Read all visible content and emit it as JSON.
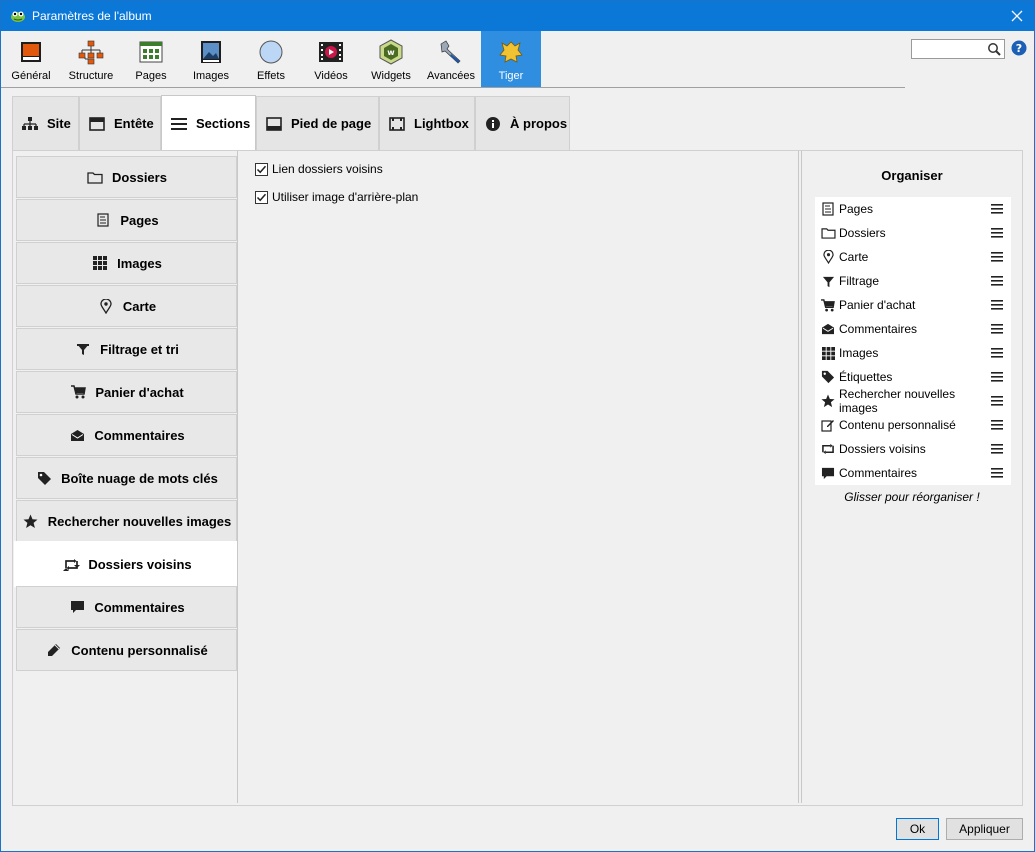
{
  "window": {
    "title": "Paramètres de l'album",
    "accent": "#0b78d7"
  },
  "toolbar": {
    "items": [
      {
        "label": "Général",
        "icon": "general-icon"
      },
      {
        "label": "Structure",
        "icon": "structure-icon"
      },
      {
        "label": "Pages",
        "icon": "pages-icon"
      },
      {
        "label": "Images",
        "icon": "images-icon"
      },
      {
        "label": "Effets",
        "icon": "effects-icon"
      },
      {
        "label": "Vidéos",
        "icon": "videos-icon"
      },
      {
        "label": "Widgets",
        "icon": "widgets-icon"
      },
      {
        "label": "Avancées",
        "icon": "advanced-icon"
      },
      {
        "label": "Tiger",
        "icon": "tiger-icon"
      }
    ],
    "active": "Tiger",
    "search_value": ""
  },
  "tabs": {
    "items": [
      {
        "label": "Site",
        "icon": "sitemap-icon"
      },
      {
        "label": "Entête",
        "icon": "header-icon"
      },
      {
        "label": "Sections",
        "icon": "list-icon"
      },
      {
        "label": "Pied de page",
        "icon": "footer-icon"
      },
      {
        "label": "Lightbox",
        "icon": "lightbox-icon"
      },
      {
        "label": "À propos",
        "icon": "info-icon"
      }
    ],
    "active": "Sections"
  },
  "sections": {
    "items": [
      {
        "label": "Dossiers",
        "icon": "folder-icon"
      },
      {
        "label": "Pages",
        "icon": "page-icon"
      },
      {
        "label": "Images",
        "icon": "grid-icon"
      },
      {
        "label": "Carte",
        "icon": "map-marker-icon"
      },
      {
        "label": "Filtrage et tri",
        "icon": "filter-icon"
      },
      {
        "label": "Panier d'achat",
        "icon": "cart-icon"
      },
      {
        "label": "Commentaires",
        "icon": "envelope-open-icon"
      },
      {
        "label": "Boîte nuage de mots clés",
        "icon": "tag-icon"
      },
      {
        "label": "Rechercher nouvelles images",
        "icon": "star-icon"
      },
      {
        "label": "Dossiers voisins",
        "icon": "retweet-icon"
      },
      {
        "label": "Commentaires",
        "icon": "comment-icon"
      },
      {
        "label": "Contenu personnalisé",
        "icon": "pencil-icon"
      }
    ],
    "active": "Dossiers voisins"
  },
  "options": {
    "link_neighbors": {
      "label": "Lien dossiers voisins",
      "checked": true
    },
    "use_background": {
      "label": "Utiliser image d'arrière-plan",
      "checked": true
    }
  },
  "organiser": {
    "title": "Organiser",
    "items": [
      {
        "label": "Pages",
        "icon": "page-icon"
      },
      {
        "label": "Dossiers",
        "icon": "folder-icon"
      },
      {
        "label": "Carte",
        "icon": "map-marker-icon"
      },
      {
        "label": "Filtrage",
        "icon": "filter-icon"
      },
      {
        "label": "Panier d'achat",
        "icon": "cart-icon"
      },
      {
        "label": "Commentaires",
        "icon": "envelope-open-icon"
      },
      {
        "label": "Images",
        "icon": "grid-icon"
      },
      {
        "label": "Étiquettes",
        "icon": "tag-icon"
      },
      {
        "label": "Rechercher nouvelles images",
        "icon": "star-icon"
      },
      {
        "label": "Contenu personnalisé",
        "icon": "edit-icon"
      },
      {
        "label": "Dossiers voisins",
        "icon": "retweet-icon"
      },
      {
        "label": "Commentaires",
        "icon": "comment-icon"
      }
    ],
    "hint": "Glisser pour réorganiser !"
  },
  "buttons": {
    "ok": "Ok",
    "apply": "Appliquer"
  }
}
